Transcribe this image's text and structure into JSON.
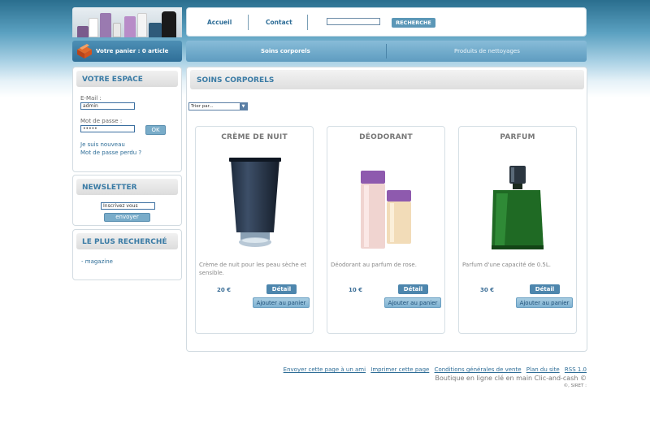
{
  "header": {
    "nav": [
      {
        "label": "Accueil"
      },
      {
        "label": "Contact"
      }
    ],
    "search": {
      "placeholder": "",
      "button_label": "RECHERCHE"
    },
    "cart_label": "Votre panier : 0 article"
  },
  "categories": [
    {
      "label": "Soins corporels"
    },
    {
      "label": "Produits de nettoyages"
    }
  ],
  "sidebar": {
    "espace": {
      "title": "VOTRE ESPACE",
      "email_label": "E-Mail :",
      "email_value": "admin",
      "password_label": "Mot de passe :",
      "password_value": "•••••",
      "ok_label": "OK",
      "new_link": "Je suis nouveau",
      "forgot_link": "Mot de passe perdu ?"
    },
    "newsletter": {
      "title": "NEWSLETTER",
      "input_value": "Inscrivez vous",
      "button_label": "envoyer"
    },
    "popular": {
      "title": "LE PLUS RECHERCHÉ",
      "items": [
        {
          "label": "- magazine"
        }
      ]
    }
  },
  "main": {
    "title": "SOINS CORPORELS",
    "sort_label": "Trier par...",
    "products": [
      {
        "name": "CRÈME DE NUIT",
        "description": "Crème de nuit pour les peau sèche et sensible.",
        "price": "20 €",
        "detail_label": "Détail",
        "cart_label": "Ajouter au panier"
      },
      {
        "name": "DÉODORANT",
        "description": "Déodorant au parfum de rose.",
        "price": "10 €",
        "detail_label": "Détail",
        "cart_label": "Ajouter au panier"
      },
      {
        "name": "PARFUM",
        "description": "Parfum d'une capacité de 0.5L.",
        "price": "30 €",
        "detail_label": "Détail",
        "cart_label": "Ajouter au panier"
      }
    ]
  },
  "footer": {
    "links": [
      {
        "label": "Envoyer cette page à un ami"
      },
      {
        "label": "Imprimer cette page"
      },
      {
        "label": "Conditions générales de vente"
      },
      {
        "label": "Plan du site"
      },
      {
        "label": "RSS 1.0"
      }
    ],
    "line1": "Boutique en ligne clé en main Clic-and-cash ©",
    "line2": "©, SIRET :"
  },
  "colors": {
    "accent": "#2e6d97",
    "header_gradient_top": "#2a6e8e",
    "button": "#4d86ad"
  }
}
